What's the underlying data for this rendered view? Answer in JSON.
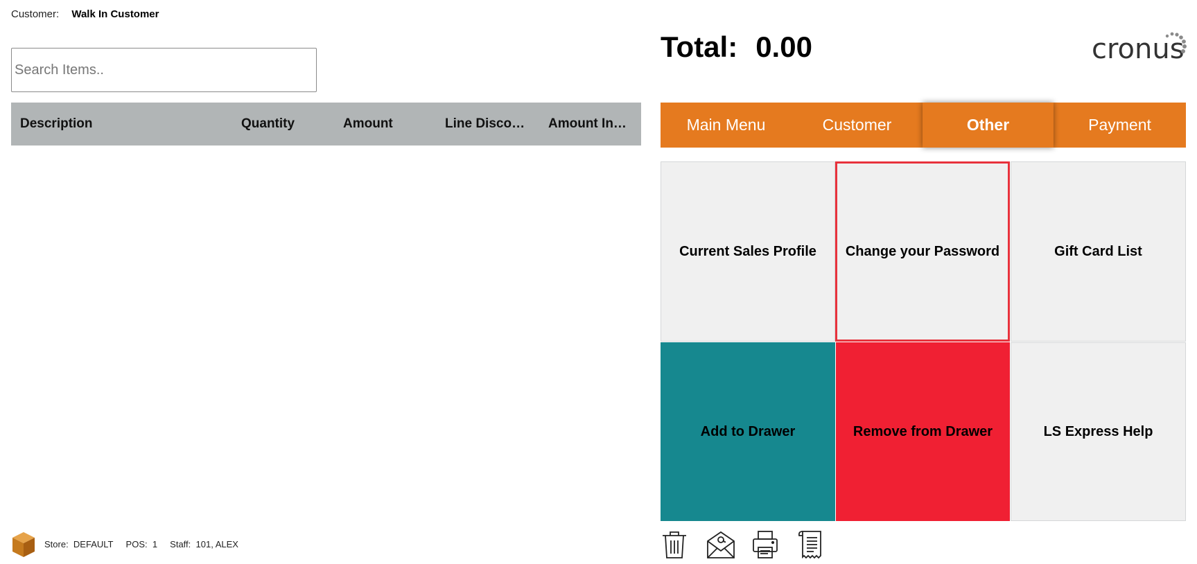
{
  "customer": {
    "label": "Customer:",
    "name": "Walk In Customer"
  },
  "search": {
    "placeholder": "Search Items..",
    "value": ""
  },
  "table": {
    "columns": [
      "Description",
      "Quantity",
      "Amount",
      "Line Disco…",
      "Amount In…"
    ],
    "rows": []
  },
  "total": {
    "label": "Total:",
    "value": "0.00"
  },
  "logo": {
    "text": "cronus"
  },
  "tabs": [
    {
      "label": "Main Menu"
    },
    {
      "label": "Customer"
    },
    {
      "label": "Other",
      "active": true
    },
    {
      "label": "Payment"
    }
  ],
  "tiles": [
    {
      "label": "Current Sales Profile",
      "style": "grey"
    },
    {
      "label": "Change your Password",
      "style": "grey",
      "selected": true
    },
    {
      "label": "Gift Card List",
      "style": "grey"
    },
    {
      "label": "Add to Drawer",
      "style": "teal"
    },
    {
      "label": "Remove from Drawer",
      "style": "red"
    },
    {
      "label": "LS Express Help",
      "style": "grey"
    }
  ],
  "footer": {
    "store_label": "Store:",
    "store": "DEFAULT",
    "pos_label": "POS:",
    "pos": "1",
    "staff_label": "Staff:",
    "staff": "101, ALEX"
  },
  "actions": [
    {
      "icon": "trash-icon"
    },
    {
      "icon": "email-icon"
    },
    {
      "icon": "printer-icon"
    },
    {
      "icon": "receipt-icon"
    }
  ],
  "colors": {
    "accent": "#e57a1f",
    "teal": "#16888f",
    "red": "#f02033",
    "header_grey": "#b1b5b6",
    "tile_grey": "#f0f0f0",
    "selection": "#e8323c"
  }
}
